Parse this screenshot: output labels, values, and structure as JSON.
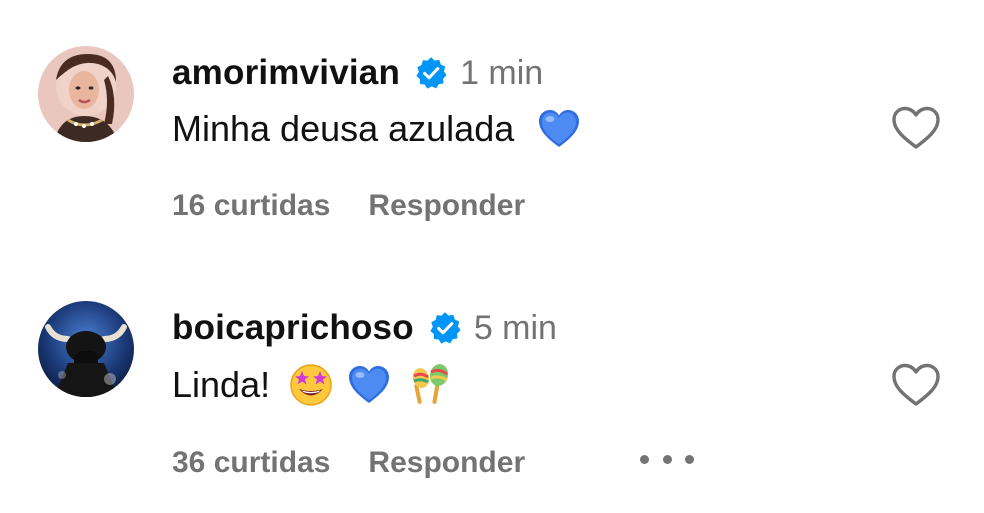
{
  "comments": [
    {
      "username": "amorimvivian",
      "time": "1 min",
      "text": "Minha deusa azulada",
      "emojis": [
        "blue-heart"
      ],
      "likes": "16 curtidas",
      "reply_label": "Responder",
      "verified": true
    },
    {
      "username": "boicaprichoso",
      "time": "5 min",
      "text": "Linda!",
      "emojis": [
        "star-struck",
        "blue-heart",
        "maracas"
      ],
      "likes": "36 curtidas",
      "reply_label": "Responder",
      "verified": true
    }
  ],
  "icons": {
    "verified": "verified-badge-icon",
    "like": "heart-outline-icon",
    "more": "more-options-icon"
  },
  "colors": {
    "verified_blue": "#0095f6",
    "secondary_text": "#737373",
    "primary_text": "#111111"
  }
}
